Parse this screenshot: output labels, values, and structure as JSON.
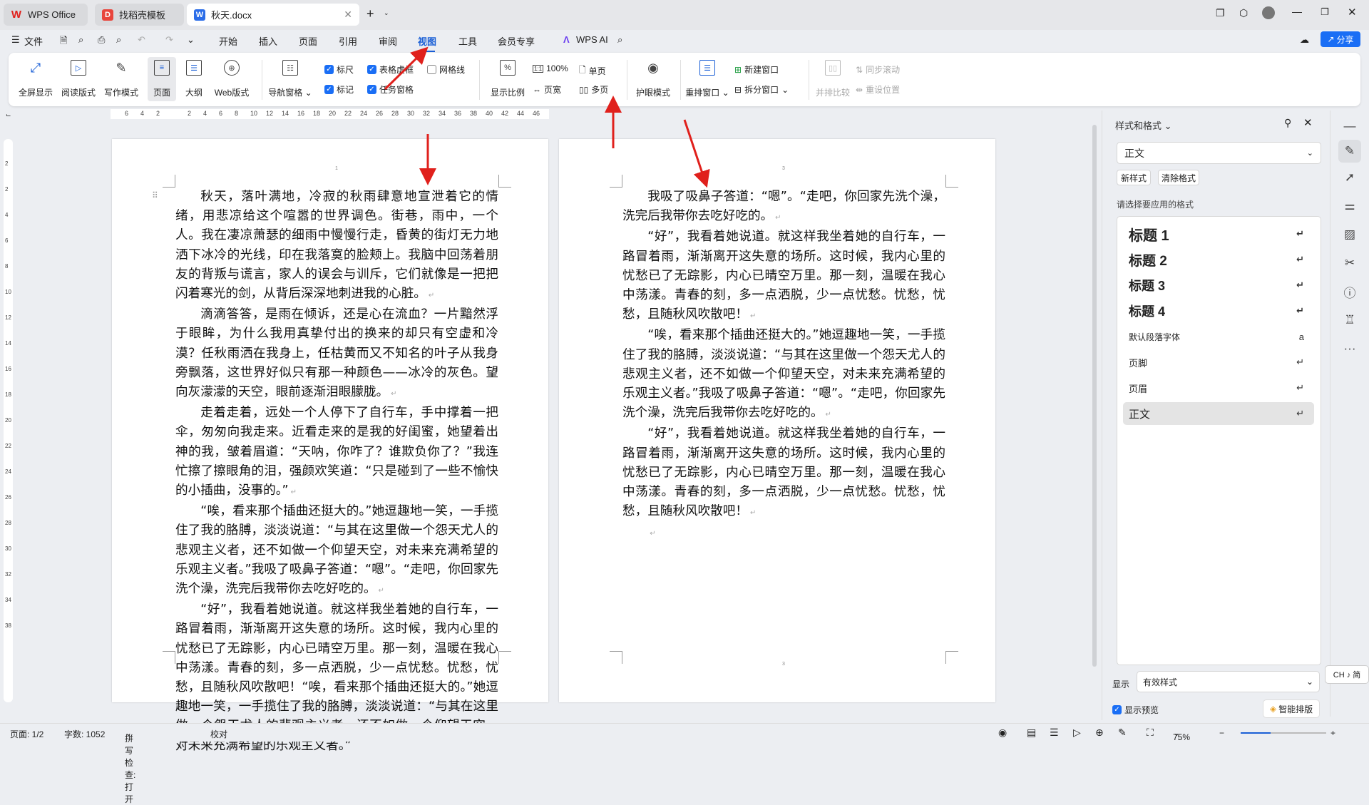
{
  "tabs": [
    {
      "label": "WPS Office",
      "icon": "wps-logo"
    },
    {
      "label": "找稻壳模板",
      "icon": "docer-logo"
    },
    {
      "label": "秋天.docx",
      "icon": "word-doc-icon"
    }
  ],
  "menu": {
    "file": "文件",
    "items": [
      "开始",
      "插入",
      "页面",
      "引用",
      "审阅",
      "视图",
      "工具",
      "会员专享"
    ],
    "active": "视图",
    "ai": "WPS AI",
    "share": "分享"
  },
  "ribbon": {
    "view_modes": [
      "全屏显示",
      "阅读版式",
      "写作模式",
      "页面",
      "大纲",
      "Web版式"
    ],
    "nav_pane": "导航窗格",
    "checks": [
      {
        "label": "标尺",
        "checked": true
      },
      {
        "label": "表格虚框",
        "checked": true
      },
      {
        "label": "网格线",
        "checked": false
      },
      {
        "label": "标记",
        "checked": true
      },
      {
        "label": "任务窗格",
        "checked": true
      }
    ],
    "zoom": "显示比例",
    "zoom100": "100%",
    "page_width": "页宽",
    "single_page": "单页",
    "multi_page": "多页",
    "eye_mode": "护眼模式",
    "rearrange": "重排窗口",
    "new_window": "新建窗口",
    "split_window": "拆分窗口",
    "side_by_side": "并排比较",
    "sync_scroll": "同步滚动",
    "reset_position": "重设位置"
  },
  "ruler": {
    "ticks": [
      "6",
      "4",
      "2",
      "",
      "2",
      "4",
      "6",
      "8",
      "10",
      "12",
      "14",
      "16",
      "18",
      "20",
      "22",
      "24",
      "26",
      "28",
      "30",
      "32",
      "34",
      "36",
      "38",
      "40",
      "42",
      "44",
      "46"
    ],
    "vticks": [
      "2",
      "2",
      "4",
      "6",
      "8",
      "10",
      "12",
      "14",
      "16",
      "18",
      "20",
      "22",
      "24",
      "26",
      "28",
      "30",
      "32",
      "34",
      "38"
    ]
  },
  "page1": {
    "paragraphs": [
      "秋天，落叶满地，冷寂的秋雨肆意地宣泄着它的情绪，用悲凉给这个喧嚣的世界调色。街巷，雨中，一个人。我在凄凉萧瑟的细雨中慢慢行走，昏黄的街灯无力地洒下冰冷的光线，印在我落寞的脸颊上。我脑中回荡着朋友的背叛与谎言，家人的误会与训斥，它们就像是一把把闪着寒光的剑，从背后深深地刺进我的心脏。",
      "滴滴答答，是雨在倾诉，还是心在流血？一片黯然浮于眼眸，为什么我用真挚付出的换来的却只有空虚和冷漠？任秋雨洒在我身上，任枯黄而又不知名的叶子从我身旁飘落，这世界好似只有那一种颜色——冰冷的灰色。望向灰濛濛的天空，眼前逐渐泪眼朦胧。",
      "走着走着，远处一个人停下了自行车，手中撑着一把伞，匆匆向我走来。近看走来的是我的好闺蜜，她望着出神的我，皱着眉道：“天呐，你咋了？谁欺负你了？”我连忙擦了擦眼角的泪，强颜欢笑道：“只是碰到了一些不愉快的小插曲，没事的。”",
      "“唉，看来那个插曲还挺大的。”她逗趣地一笑，一手揽住了我的胳膊，淡淡说道：“与其在这里做一个怨天尤人的悲观主义者，还不如做一个仰望天空，对未来充满希望的乐观主义者。”我吸了吸鼻子答道：“嗯”。“走吧，你回家先洗个澡，洗完后我带你去吃好吃的。",
      "“好”，我看着她说道。就这样我坐着她的自行车，一路冒着雨，渐渐离开这失意的场所。这时候，我内心里的忧愁已了无踪影，内心已晴空万里。那一刻，温暖在我心中荡漾。青春的刻，多一点洒脱，少一点忧愁。忧愁，忧愁，且随秋风吹散吧！“唉，看来那个插曲还挺大的。”她逗趣地一笑，一手揽住了我的胳膊，淡淡说道：“与其在这里做一个怨天尤人的悲观主义者，还不如做一个仰望天空，对未来充满希望的乐观主义者。”"
    ],
    "num": "1"
  },
  "page2": {
    "paragraphs": [
      "我吸了吸鼻子答道：“嗯”。“走吧，你回家先洗个澡，洗完后我带你去吃好吃的。",
      "“好”，我看着她说道。就这样我坐着她的自行车，一路冒着雨，渐渐离开这失意的场所。这时候，我内心里的忧愁已了无踪影，内心已晴空万里。那一刻，温暖在我心中荡漾。青春的刻，多一点洒脱，少一点忧愁。忧愁，忧愁，且随秋风吹散吧！",
      "“唉，看来那个插曲还挺大的。”她逗趣地一笑，一手揽住了我的胳膊，淡淡说道：“与其在这里做一个怨天尤人的悲观主义者，还不如做一个仰望天空，对未来充满希望的乐观主义者。”我吸了吸鼻子答道：“嗯”。“走吧，你回家先洗个澡，洗完后我带你去吃好吃的。",
      "“好”，我看着她说道。就这样我坐着她的自行车，一路冒着雨，渐渐离开这失意的场所。这时候，我内心里的忧愁已了无踪影，内心已晴空万里。那一刻，温暖在我心中荡漾。青春的刻，多一点洒脱，少一点忧愁。忧愁，忧愁，且随秋风吹散吧！"
    ],
    "num": "3"
  },
  "panel": {
    "title": "样式和格式",
    "current": "正文",
    "new_style": "新样式",
    "clear_format": "清除格式",
    "prompt": "请选择要应用的格式",
    "styles": [
      "标题 1",
      "标题 2",
      "标题 3",
      "标题 4",
      "默认段落字体",
      "页脚",
      "页眉",
      "正文"
    ],
    "show_label": "显示",
    "show_value": "有效样式",
    "preview": "显示预览",
    "smart_layout": "智能排版",
    "ime": "CH ♪ 简"
  },
  "status": {
    "page": "页面: 1/2",
    "words": "字数: 1052",
    "spell": "拼写检查: 打开",
    "proof": "校对",
    "zoom": "75%"
  },
  "colors": {
    "accent": "#1a5fd6",
    "annotation": "#e0201c"
  }
}
